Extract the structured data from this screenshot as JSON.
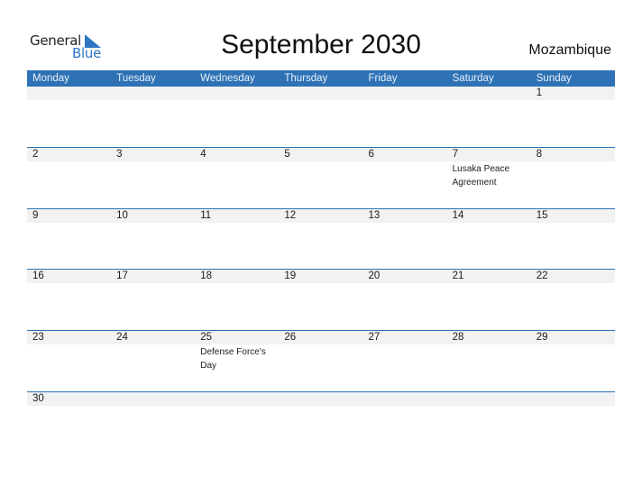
{
  "logo": {
    "word1": "General",
    "word2": "Blue"
  },
  "title": "September 2030",
  "country": "Mozambique",
  "colors": {
    "accent": "#2e72b5",
    "strip": "#f2f2f2"
  },
  "weekdays": [
    "Monday",
    "Tuesday",
    "Wednesday",
    "Thursday",
    "Friday",
    "Saturday",
    "Sunday"
  ],
  "weeks": [
    {
      "days": [
        "",
        "",
        "",
        "",
        "",
        "",
        "1"
      ],
      "events": [
        "",
        "",
        "",
        "",
        "",
        "",
        ""
      ]
    },
    {
      "days": [
        "2",
        "3",
        "4",
        "5",
        "6",
        "7",
        "8"
      ],
      "events": [
        "",
        "",
        "",
        "",
        "",
        "Lusaka Peace Agreement",
        ""
      ]
    },
    {
      "days": [
        "9",
        "10",
        "11",
        "12",
        "13",
        "14",
        "15"
      ],
      "events": [
        "",
        "",
        "",
        "",
        "",
        "",
        ""
      ]
    },
    {
      "days": [
        "16",
        "17",
        "18",
        "19",
        "20",
        "21",
        "22"
      ],
      "events": [
        "",
        "",
        "",
        "",
        "",
        "",
        ""
      ]
    },
    {
      "days": [
        "23",
        "24",
        "25",
        "26",
        "27",
        "28",
        "29"
      ],
      "events": [
        "",
        "",
        "Defense Force's Day",
        "",
        "",
        "",
        ""
      ]
    },
    {
      "days": [
        "30",
        "",
        "",
        "",
        "",
        "",
        ""
      ],
      "events": [
        "",
        "",
        "",
        "",
        "",
        "",
        ""
      ]
    }
  ]
}
